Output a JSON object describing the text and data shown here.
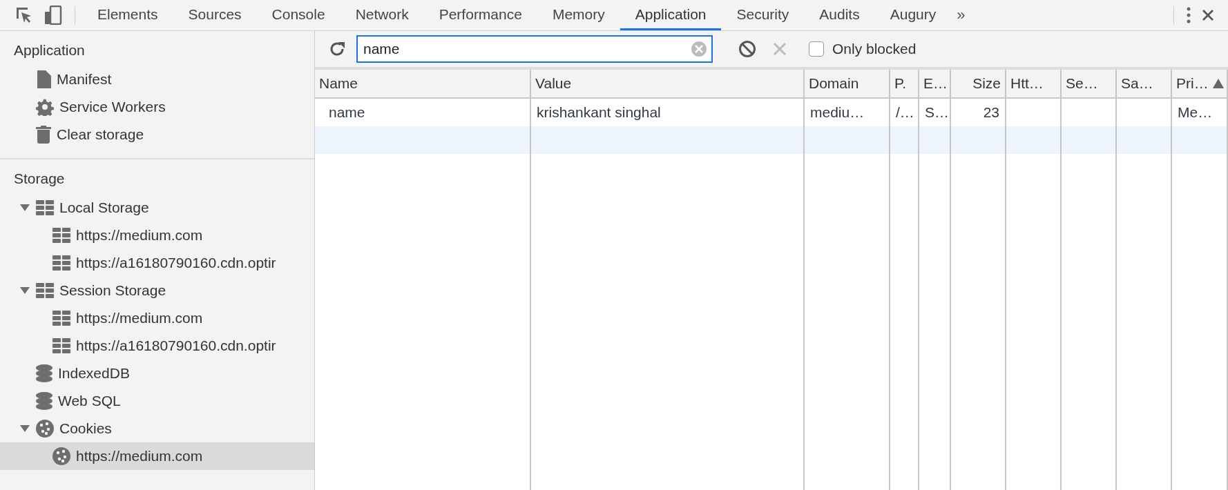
{
  "tabs": [
    {
      "label": "Elements",
      "selected": false
    },
    {
      "label": "Sources",
      "selected": false
    },
    {
      "label": "Console",
      "selected": false
    },
    {
      "label": "Network",
      "selected": false
    },
    {
      "label": "Performance",
      "selected": false
    },
    {
      "label": "Memory",
      "selected": false
    },
    {
      "label": "Application",
      "selected": true
    },
    {
      "label": "Security",
      "selected": false
    },
    {
      "label": "Audits",
      "selected": false
    },
    {
      "label": "Augury",
      "selected": false
    }
  ],
  "overflow": "»",
  "sidebar": {
    "sections": [
      {
        "title": "Application",
        "items": [
          {
            "label": "Manifest",
            "kind": "file",
            "selected": false
          },
          {
            "label": "Service Workers",
            "kind": "gear",
            "selected": false
          },
          {
            "label": "Clear storage",
            "kind": "trash",
            "selected": false
          }
        ]
      },
      {
        "title": "Storage",
        "items": [
          {
            "label": "Local Storage",
            "kind": "grid",
            "selected": false,
            "expanded": true,
            "children": [
              {
                "label": "https://medium.com",
                "kind": "grid",
                "selected": false
              },
              {
                "label": "https://a16180790160.cdn.optir",
                "kind": "grid",
                "selected": false
              }
            ]
          },
          {
            "label": "Session Storage",
            "kind": "grid",
            "selected": false,
            "expanded": true,
            "children": [
              {
                "label": "https://medium.com",
                "kind": "grid",
                "selected": false
              },
              {
                "label": "https://a16180790160.cdn.optir",
                "kind": "grid",
                "selected": false
              }
            ]
          },
          {
            "label": "IndexedDB",
            "kind": "database",
            "selected": false
          },
          {
            "label": "Web SQL",
            "kind": "database",
            "selected": false
          },
          {
            "label": "Cookies",
            "kind": "cookie",
            "selected": false,
            "expanded": true,
            "children": [
              {
                "label": "https://medium.com",
                "kind": "cookie",
                "selected": true
              }
            ]
          }
        ]
      }
    ]
  },
  "toolbar": {
    "filter": {
      "value": "name"
    },
    "delete_disabled": true,
    "only_blocked": {
      "label": "Only blocked",
      "checked": false
    }
  },
  "table": {
    "columns": [
      {
        "label": "Name",
        "sorted": false
      },
      {
        "label": "Value",
        "sorted": false
      },
      {
        "label": "Domain",
        "sorted": false
      },
      {
        "label": "P.",
        "sorted": false
      },
      {
        "label": "E…",
        "sorted": false
      },
      {
        "label": "Size",
        "sorted": false
      },
      {
        "label": "Htt…",
        "sorted": false
      },
      {
        "label": "Se…",
        "sorted": false
      },
      {
        "label": "Sa…",
        "sorted": false
      },
      {
        "label": "Pri…",
        "sorted": true
      }
    ],
    "rows": [
      {
        "cells": [
          "name",
          "krishankant singhal",
          "mediu…",
          "/…",
          "S…",
          "23",
          "",
          "",
          "",
          "Me…"
        ]
      }
    ]
  }
}
